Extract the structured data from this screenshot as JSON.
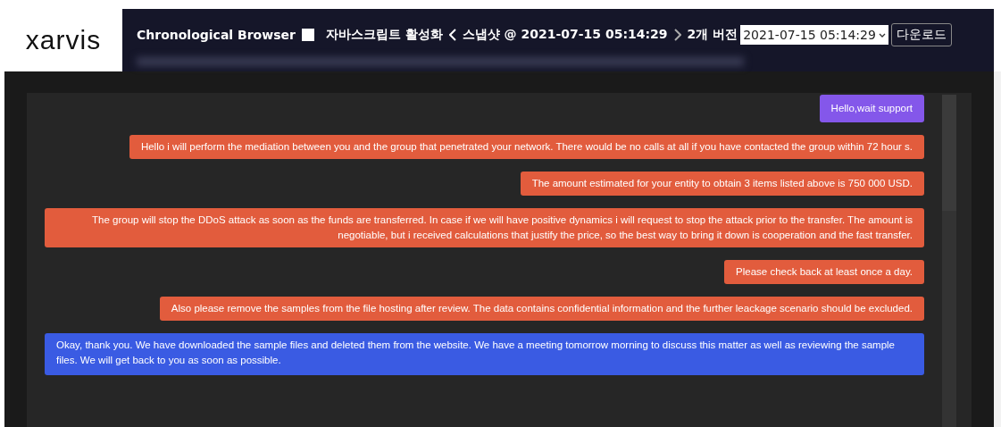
{
  "logo": "xarvis",
  "header": {
    "app_title": "Chronological Browser",
    "javascript_toggle": "자바스크립트 활성화",
    "snapshot": "스냅샷 @ 2021-07-15 05:14:29",
    "versions": "2개 버전",
    "version_select": "2021-07-15 05:14:29",
    "download_button": "다운로드"
  },
  "messages": [
    {
      "kind": "support",
      "text": "Hello,wait support"
    },
    {
      "kind": "negotiator",
      "text": "Hello i will perform the mediation between you and the group that penetrated your network. There would be no calls at all if you have contacted the group within 72 hour s."
    },
    {
      "kind": "negotiator",
      "text": "The amount estimated for your entity to obtain 3 items listed above is 750 000 USD."
    },
    {
      "kind": "negotiator",
      "text": "The group will stop the DDoS attack as soon as the funds are transferred. In case if we will have positive dynamics i will request to stop the attack prior to the transfer. The amount is negotiable, but i received calculations that justify the price, so the best way to bring it down is cooperation and the fast transfer."
    },
    {
      "kind": "negotiator",
      "text": "Please check back at least once a day."
    },
    {
      "kind": "negotiator",
      "text": "Also please remove the samples from the file hosting after review. The data contains confidential information and the further leackage scenario should be excluded."
    },
    {
      "kind": "victim",
      "text": "Okay, thank you. We have downloaded the sample files and deleted them from the website. We have a meeting tomorrow morning to discuss this matter as well as reviewing the sample files. We will get back to you as soon as possible."
    }
  ]
}
